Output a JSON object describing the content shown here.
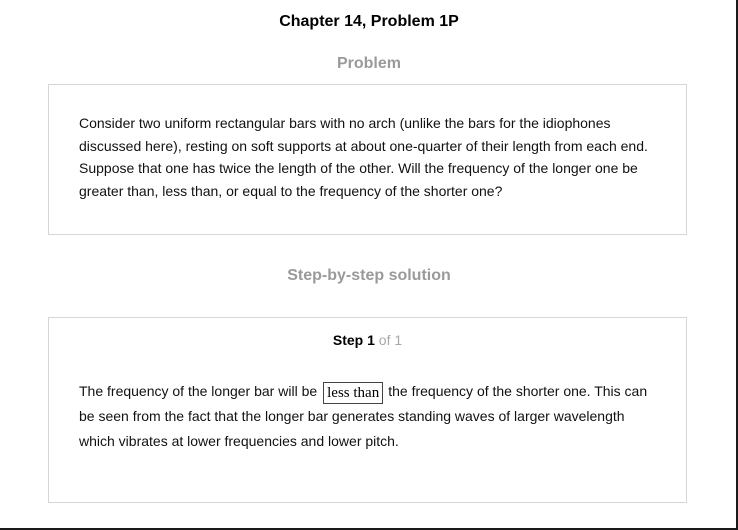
{
  "header": {
    "title": "Chapter 14, Problem 1P"
  },
  "problem": {
    "heading": "Problem",
    "text": "Consider two uniform rectangular bars with no arch (unlike the bars for the idiophones discussed here), resting on soft supports at about one-quarter of their length from each end. Suppose that one has twice the length of the other. Will the frequency of the longer one be greater than, less than, or equal to the frequency of the shorter one?"
  },
  "solution": {
    "heading": "Step-by-step solution",
    "step": {
      "label": "Step",
      "number": "1",
      "of_total": "of 1"
    },
    "text_before": "The frequency of the longer bar will be",
    "answer": "less than",
    "text_after": "the frequency of the shorter one. This can be seen from the fact that the longer bar generates standing waves of larger wavelength which vibrates at lower frequencies and lower pitch."
  }
}
